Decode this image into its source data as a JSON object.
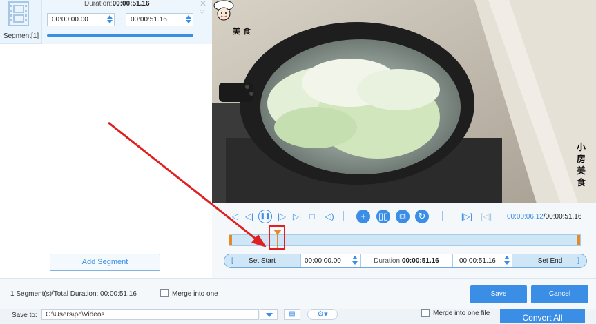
{
  "segment": {
    "label": "Segment[1]",
    "duration_label": "Duration:",
    "duration_value": "00:00:51.16",
    "start": "00:00:00.00",
    "separator": "–",
    "end": "00:00:51.16",
    "close_glyph": "✕",
    "move_glyph": "◇"
  },
  "left": {
    "add_segment": "Add Segment"
  },
  "video": {
    "watermark_top": "美食",
    "watermark_side": "小房美食"
  },
  "controls": {
    "icons": [
      "go-start-icon",
      "prev-frame-icon",
      "pause-icon",
      "next-frame-icon",
      "go-end-icon",
      "stop-icon",
      "volume-icon",
      "add-segment-icon",
      "copy-segment-icon",
      "merge-icon",
      "reset-icon",
      "set-start-marker-icon",
      "set-end-marker-icon"
    ],
    "current_time": "00:00:06.12",
    "total_time": "/00:00:51.16",
    "playhead_fraction": 0.12
  },
  "setbar": {
    "bracket_left": "[",
    "set_start": "Set Start",
    "start_time": "00:00:00.00",
    "duration_label": "Duration:",
    "duration_value": "00:00:51.16",
    "end_time": "00:00:51.16",
    "set_end": "Set End",
    "bracket_right": "]"
  },
  "dialog": {
    "summary": "1 Segment(s)/Total Duration: 00:00:51.16",
    "merge_label": "Merge into one",
    "save": "Save",
    "cancel": "Cancel"
  },
  "main": {
    "save_to_label": "Save to:",
    "path": "C:\\Users\\pc\\Videos",
    "merge_label": "Merge into one file",
    "convert_all": "Convert All",
    "folder_glyph": "▤",
    "gear_glyph": "⚙▾"
  },
  "colors": {
    "accent": "#3a8ee6",
    "marker": "#e58a2b",
    "annotation": "#e02020"
  }
}
